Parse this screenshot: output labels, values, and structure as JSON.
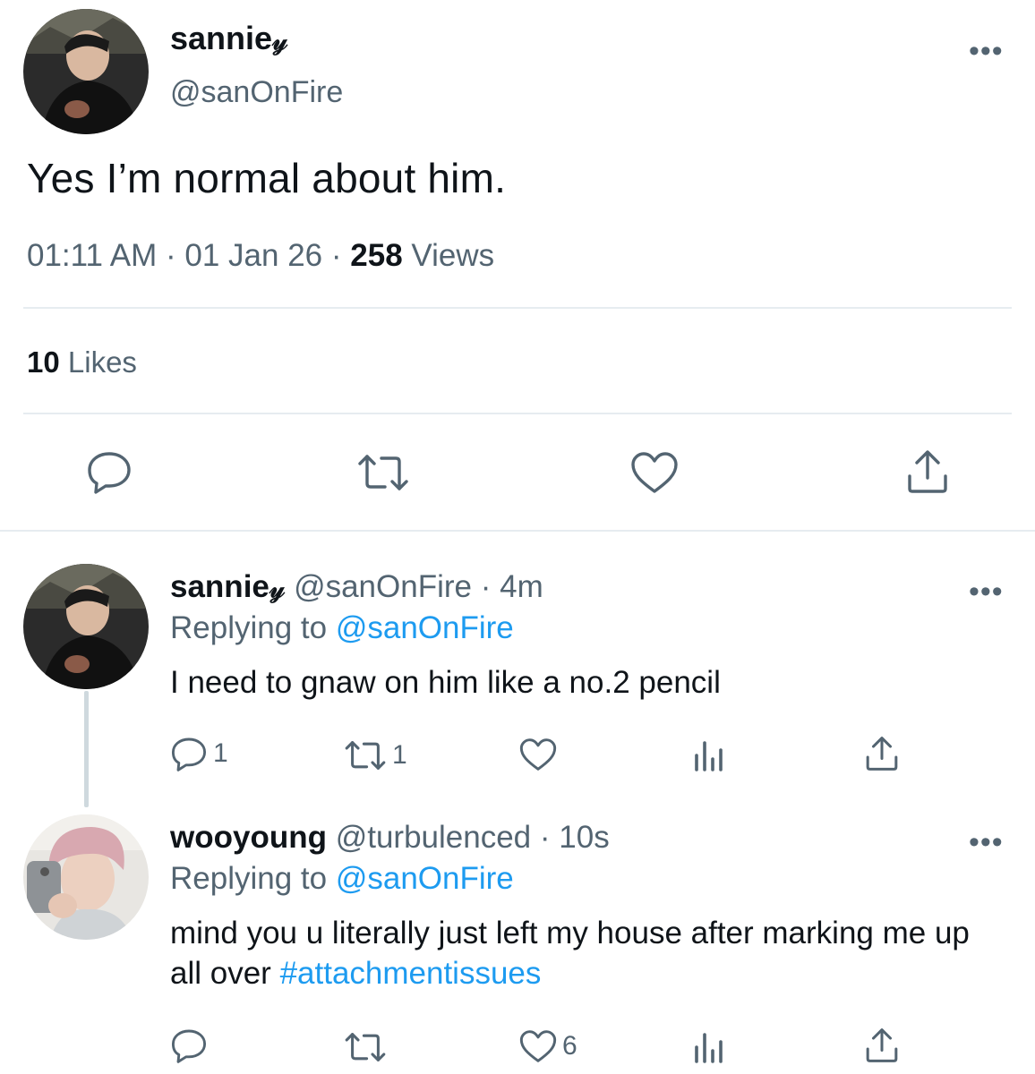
{
  "main_tweet": {
    "display_name": "sannie",
    "name_symbol": "𝓎",
    "handle": "@sanOnFire",
    "more": "•••",
    "text": "Yes I’m normal about him.",
    "time": "01:11 AM",
    "date": "01 Jan 26",
    "views_count": "258",
    "views_label": "Views",
    "likes_count": "10",
    "likes_label": "Likes",
    "actions": [
      "reply-icon",
      "retweet-icon",
      "like-icon",
      "share-icon"
    ]
  },
  "replies": [
    {
      "display_name": "sannie",
      "name_symbol": "𝓎",
      "handle": "@sanOnFire",
      "age": "4m",
      "more": "•••",
      "replying_label": "Replying to",
      "replying_to": "@sanOnFire",
      "text": "I need to gnaw on him like a no.2 pencil",
      "reply_count": "1",
      "retweet_count": "1",
      "like_count": ""
    },
    {
      "display_name": "wooyoung",
      "handle": "@turbulenced",
      "age": "10s",
      "more": "•••",
      "replying_label": "Replying to",
      "replying_to": "@sanOnFire",
      "text": "mind you u literally just left my house after marking me up all over",
      "hashtag": "#attachmentissues",
      "reply_count": "",
      "retweet_count": "",
      "like_count": "6"
    }
  ],
  "colors": {
    "text": "#0f1419",
    "secondary": "#536471",
    "link": "#1d9bf0",
    "divider": "#e6ecf0"
  }
}
